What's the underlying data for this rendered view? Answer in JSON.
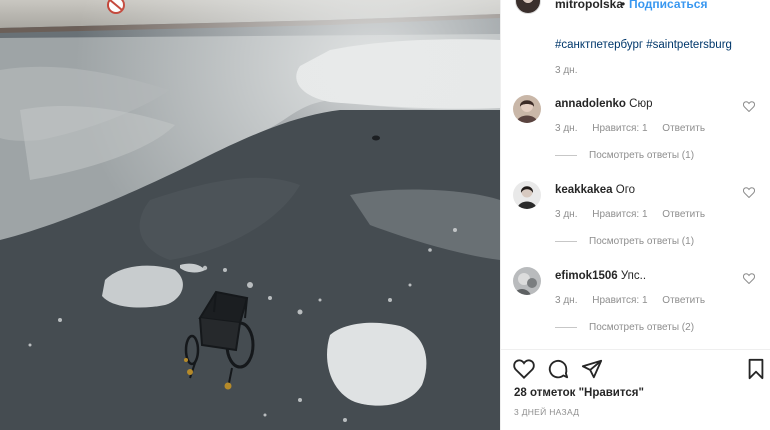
{
  "header": {
    "username": "mitropolska",
    "separator": "•",
    "follow_label": "Подписаться",
    "more_label": "•••"
  },
  "caption": {
    "hashtags": [
      "#санктпетербург",
      "#saintpetersburg"
    ],
    "time": "3 дн."
  },
  "comments": [
    {
      "username": "annadolenko",
      "text": "Сюр",
      "time": "3 дн.",
      "likes": "Нравится: 1",
      "reply_label": "Ответить",
      "view_replies": "Посмотреть ответы (1)"
    },
    {
      "username": "keakkakea",
      "text": "Ого",
      "time": "3 дн.",
      "likes": "Нравится: 1",
      "reply_label": "Ответить",
      "view_replies": "Посмотреть ответы (1)"
    },
    {
      "username": "efimok1506",
      "text": "Упс..",
      "time": "3 дн.",
      "likes": "Нравится: 1",
      "reply_label": "Ответить",
      "view_replies": "Посмотреть ответы (2)"
    }
  ],
  "icons": {
    "like": "heart-icon",
    "comment": "comment-icon",
    "share": "send-icon",
    "save": "bookmark-icon"
  },
  "likes_count": "28 отметок \"Нравится\"",
  "post_date": "3 ДНЕЙ НАЗАД",
  "colors": {
    "link": "#3897f0",
    "hashtag": "#00376b",
    "muted": "#8e8e8e",
    "text": "#262626"
  }
}
